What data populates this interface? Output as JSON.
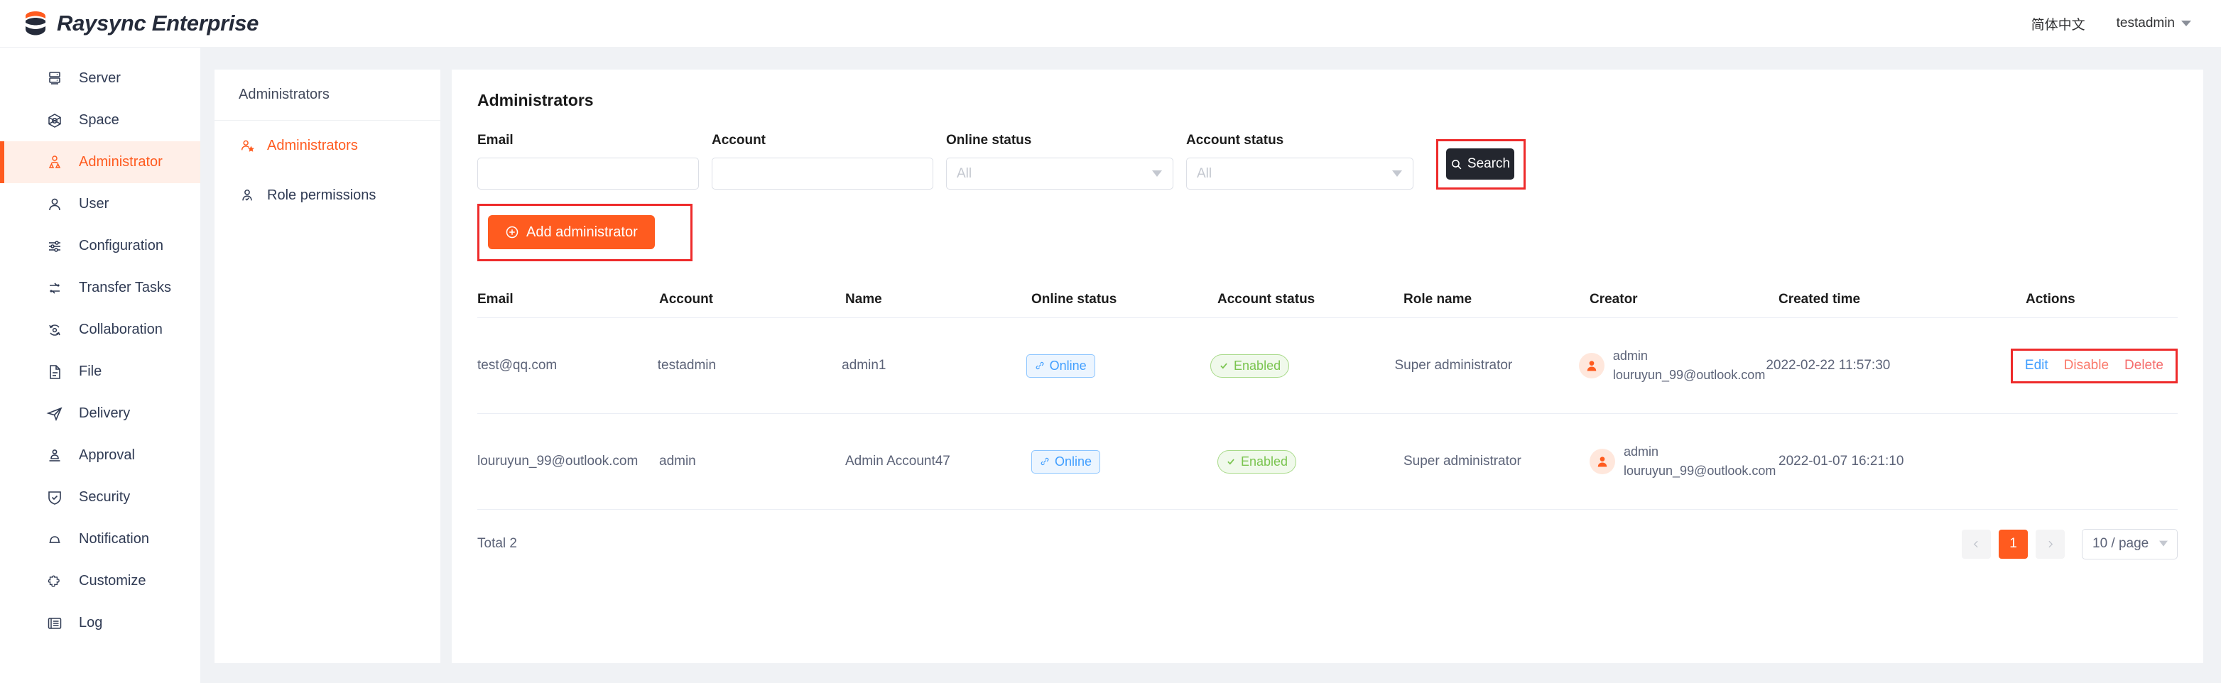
{
  "header": {
    "brand": "Raysync Enterprise",
    "brand_logo_icon": "raysync-layers-logo",
    "language": "简体中文",
    "user": "testadmin",
    "user_caret_icon": "caret-down-icon"
  },
  "colors": {
    "accent_orange": "#ff5b1f",
    "annotation_red": "#ee2b2b",
    "dark_button": "#23262e",
    "online_blue": "#409eff",
    "enabled_green": "#7ac44f",
    "page_background": "#f0f2f5"
  },
  "sidebar": {
    "items": [
      {
        "label": "Server",
        "icon": "server-icon",
        "active": false
      },
      {
        "label": "Space",
        "icon": "space-icon",
        "active": false
      },
      {
        "label": "Administrator",
        "icon": "administrator-icon",
        "active": true
      },
      {
        "label": "User",
        "icon": "user-icon",
        "active": false
      },
      {
        "label": "Configuration",
        "icon": "sliders-icon",
        "active": false
      },
      {
        "label": "Transfer Tasks",
        "icon": "transfer-icon",
        "active": false
      },
      {
        "label": "Collaboration",
        "icon": "collaboration-icon",
        "active": false
      },
      {
        "label": "File",
        "icon": "file-icon",
        "active": false
      },
      {
        "label": "Delivery",
        "icon": "delivery-icon",
        "active": false
      },
      {
        "label": "Approval",
        "icon": "approval-stamp-icon",
        "active": false
      },
      {
        "label": "Security",
        "icon": "shield-check-icon",
        "active": false
      },
      {
        "label": "Notification",
        "icon": "bell-icon",
        "active": false
      },
      {
        "label": "Customize",
        "icon": "puzzle-icon",
        "active": false
      },
      {
        "label": "Log",
        "icon": "log-list-icon",
        "active": false
      }
    ]
  },
  "subpanel": {
    "title": "Administrators",
    "items": [
      {
        "label": "Administrators",
        "icon": "admin-star-icon",
        "active": true
      },
      {
        "label": "Role permissions",
        "icon": "user-check-icon",
        "active": false
      }
    ]
  },
  "main": {
    "page_title": "Administrators",
    "filters": {
      "email": {
        "label": "Email",
        "value": "",
        "placeholder": ""
      },
      "account": {
        "label": "Account",
        "value": "",
        "placeholder": ""
      },
      "online_status": {
        "label": "Online status",
        "value": "All",
        "chevron_icon": "chevron-down-icon"
      },
      "account_status": {
        "label": "Account status",
        "value": "All",
        "chevron_icon": "chevron-down-icon"
      },
      "search_button": {
        "label": "Search",
        "icon": "search-icon",
        "highlighted": true
      }
    },
    "add_button": {
      "label": "Add administrator",
      "icon": "plus-circle-icon",
      "highlighted": true
    },
    "table": {
      "columns": [
        "Email",
        "Account",
        "Name",
        "Online status",
        "Account status",
        "Role name",
        "Creator",
        "Created time",
        "Actions"
      ],
      "rows": [
        {
          "email": "test@qq.com",
          "account": "testadmin",
          "name": "admin1",
          "online_status": "Online",
          "online_icon": "link-chain-icon",
          "account_status": "Enabled",
          "account_icon": "check-icon",
          "role_name": "Super administrator",
          "creator_avatar_icon": "user-avatar-icon",
          "creator_name": "admin",
          "creator_email": "louruyun_99@outlook.com",
          "created_time": "2022-02-22 11:57:30",
          "actions": [
            "Edit",
            "Disable",
            "Delete"
          ],
          "actions_highlighted": true
        },
        {
          "email": "louruyun_99@outlook.com",
          "account": "admin",
          "name": "Admin Account47",
          "online_status": "Online",
          "online_icon": "link-chain-icon",
          "account_status": "Enabled",
          "account_icon": "check-icon",
          "role_name": "Super administrator",
          "creator_avatar_icon": "user-avatar-icon",
          "creator_name": "admin",
          "creator_email": "louruyun_99@outlook.com",
          "created_time": "2022-01-07 16:21:10",
          "actions": [],
          "actions_highlighted": false
        }
      ]
    },
    "pagination": {
      "total_text": "Total 2",
      "prev_icon": "chevron-left-icon",
      "current_page": "1",
      "next_icon": "chevron-right-icon",
      "page_size": "10 / page",
      "page_size_chevron_icon": "chevron-down-icon"
    }
  }
}
